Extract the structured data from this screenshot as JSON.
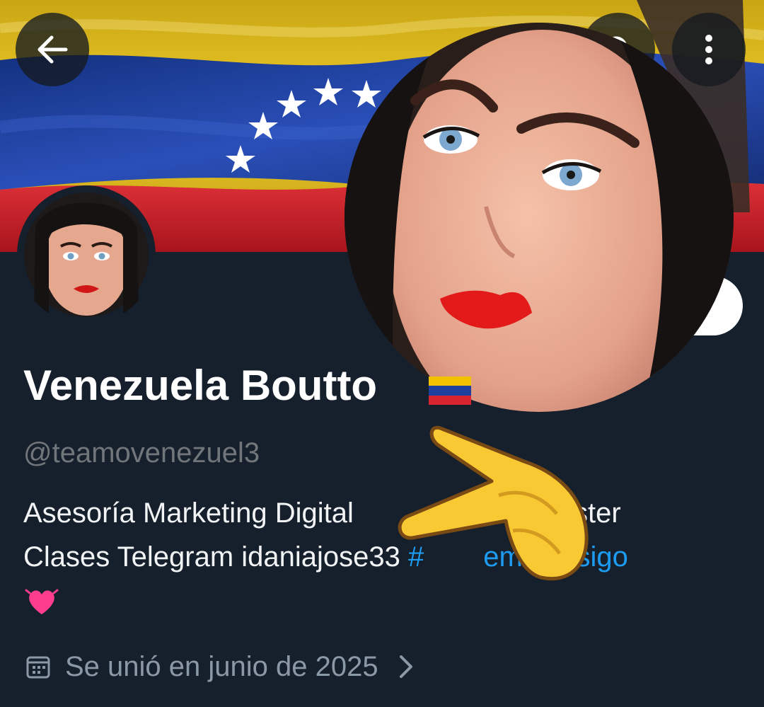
{
  "header": {
    "back_icon": "arrow-left-icon",
    "search_icon": "search-icon",
    "more_icon": "more-vertical-icon"
  },
  "profile": {
    "display_name": "Venezuela Boutto",
    "name_badge": "venezuela-flag-emoji",
    "handle": "@teamovenezuel3",
    "bio_line_1": "Asesoría Marketing Digital",
    "bio_line_1_end": "ón Máster",
    "bio_line_2": "Clases Telegram idaniajose33 ",
    "bio_hashtag_visible": "#",
    "bio_hashtag_end": "emeytesigo",
    "bio_emoji": "pink-heart-emoji",
    "joined": "Se unió en junio de 2025"
  },
  "colors": {
    "background": "#16202c",
    "hashtag_blue": "#1d9bf0",
    "handle_gray": "#71767b",
    "flag_yellow": "#e8c21a",
    "flag_blue": "#1f3f9e",
    "flag_red": "#d8242e"
  },
  "overlays": {
    "zoomed_avatar": "enlarged-profile-photo",
    "pointer": "backhand-index-pointing-left-emoji"
  }
}
